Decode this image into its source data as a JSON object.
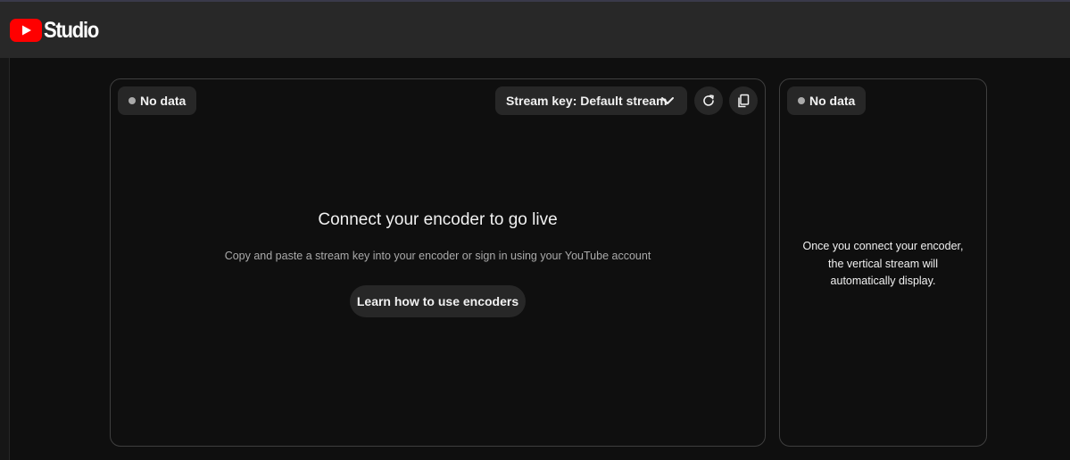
{
  "app": {
    "title": "Studio",
    "logo_icon": "youtube-play-icon",
    "brand_color": "#ff0000"
  },
  "main_panel": {
    "status": "No data",
    "stream_key_label": "Stream key: Default stream",
    "refresh_icon": "refresh-icon",
    "copy_icon": "copy-icon",
    "heading": "Connect your encoder to go live",
    "subtext": "Copy and paste a stream key into your encoder or sign in using your YouTube account",
    "learn_button": "Learn how to use encoders"
  },
  "side_panel": {
    "status": "No data",
    "message_lines": [
      "Once you connect your encoder,",
      "the vertical stream will",
      "automatically display."
    ]
  }
}
